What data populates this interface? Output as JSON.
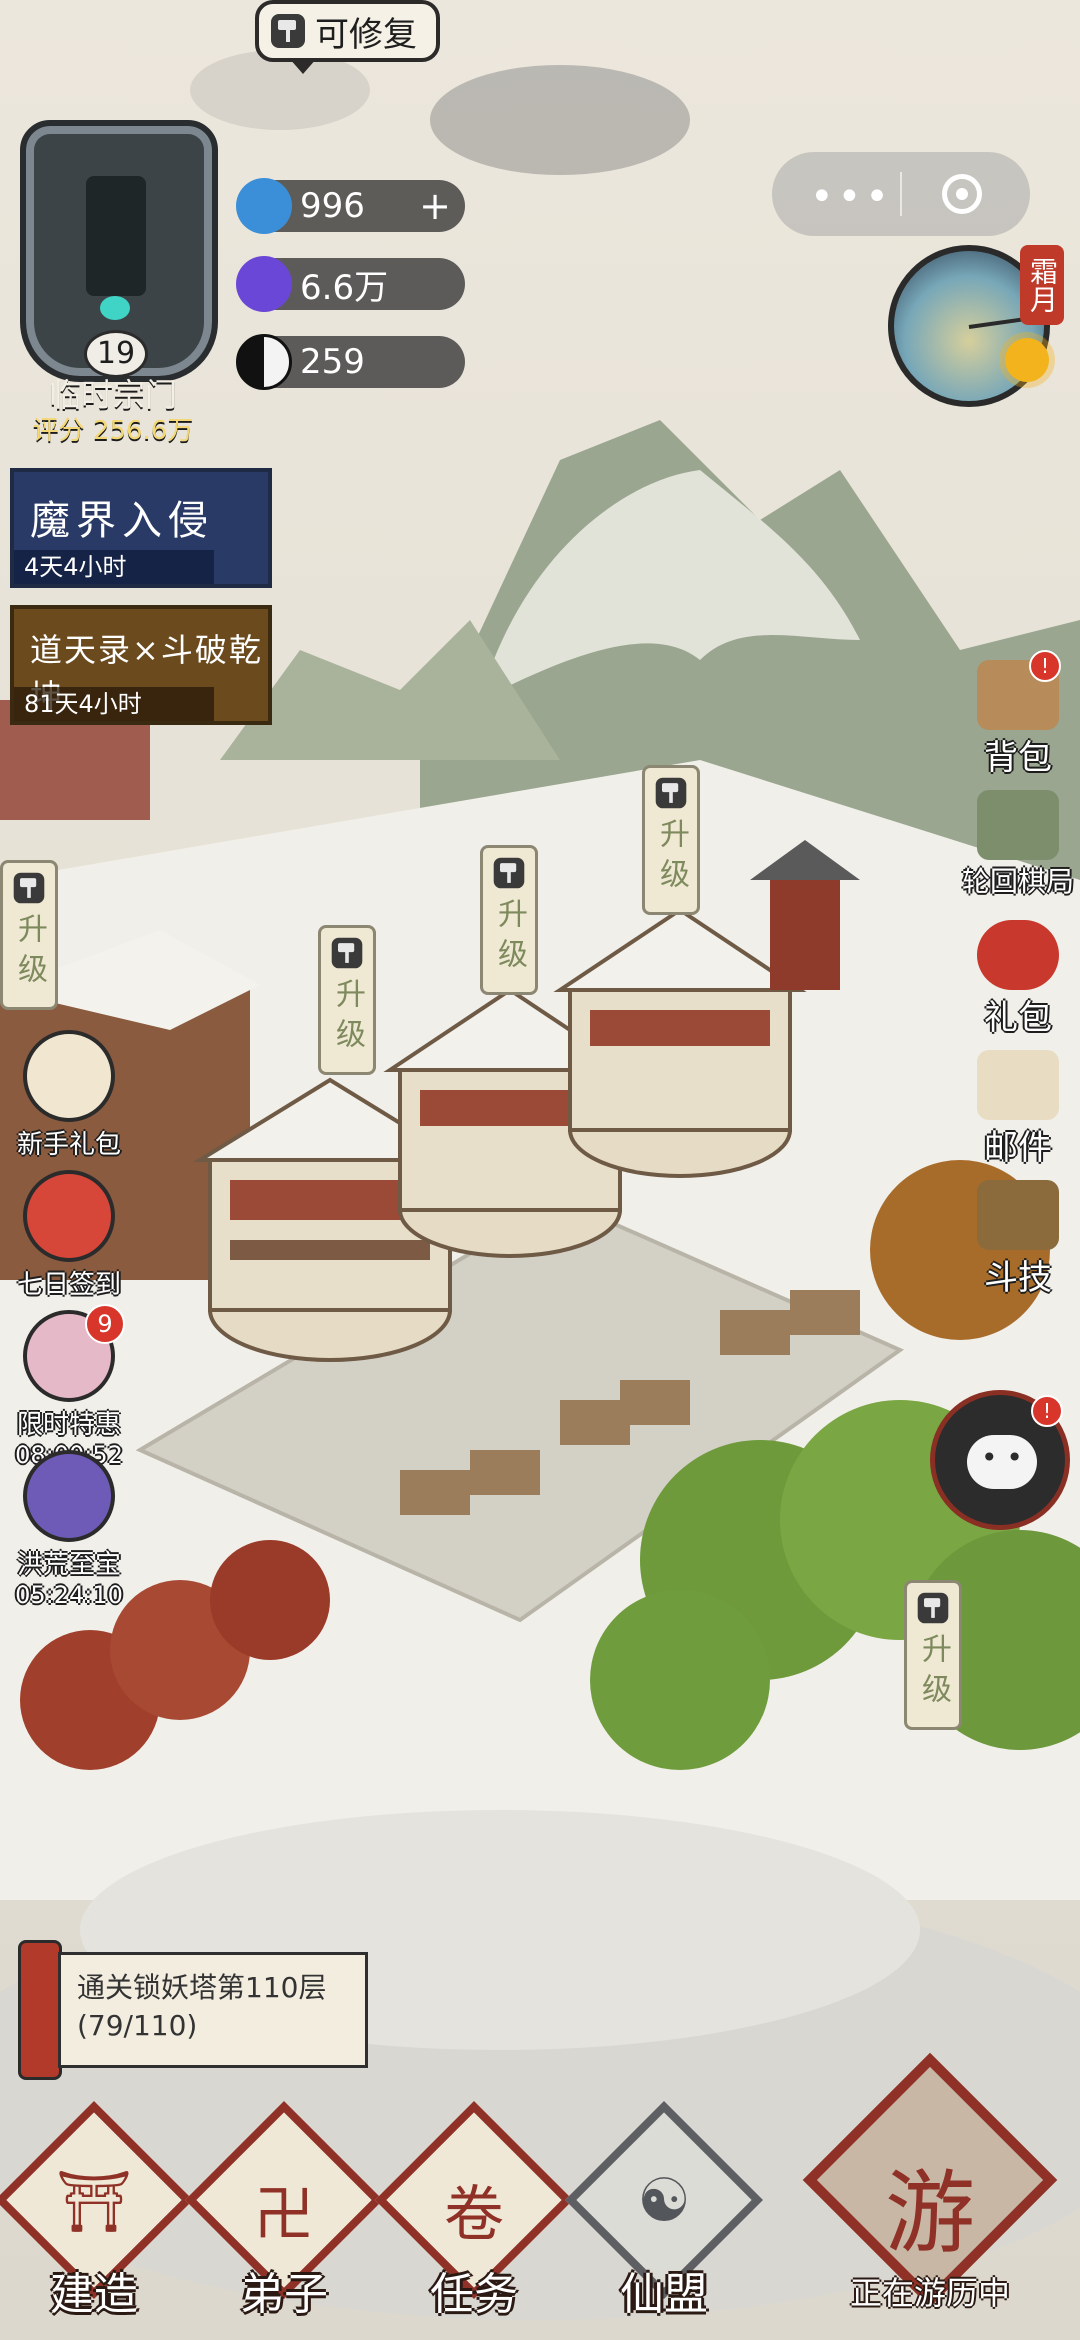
{
  "repair_tag": {
    "label": "可修复",
    "icon": "hammer-icon"
  },
  "sect": {
    "level": "19",
    "name": "临时宗门",
    "score": "评分 256.6万"
  },
  "currencies": [
    {
      "name": "spirit-coin",
      "value": "996",
      "has_plus": true,
      "color": "#3b8fd8"
    },
    {
      "name": "crystal",
      "value": "6.6万",
      "has_plus": false,
      "color": "#6a47d6"
    },
    {
      "name": "yin-yang",
      "value": "259",
      "has_plus": false,
      "color": "#222222"
    }
  ],
  "capsule": {
    "more_icon": "more-dots-icon",
    "close_icon": "target-icon"
  },
  "season": {
    "month_label": "霜月",
    "icon": "sun-icon"
  },
  "events": [
    {
      "title": "魔界入侵",
      "timer": "4天4小时",
      "bg": "#2a3a66"
    },
    {
      "title": "道天录×斗破乾坤",
      "timer": "81天4小时",
      "bg": "#6b4a1e"
    }
  ],
  "left_promos": [
    {
      "label": "新手礼包",
      "timer": "",
      "badge": ""
    },
    {
      "label": "七日签到",
      "timer": "",
      "badge": ""
    },
    {
      "label": "限时特惠",
      "timer": "08:00:52",
      "badge": "9"
    },
    {
      "label": "洪荒至宝",
      "timer": "05:24:10",
      "badge": ""
    }
  ],
  "right_menu": [
    {
      "label": "背包",
      "alert": "!"
    },
    {
      "label": "轮回棋局",
      "alert": ""
    },
    {
      "label": "礼包",
      "alert": ""
    },
    {
      "label": "邮件",
      "alert": ""
    },
    {
      "label": "斗技",
      "alert": ""
    }
  ],
  "chat": {
    "alert": "!"
  },
  "upgrade_label": "升级",
  "quest": {
    "text": "通关锁妖塔第110层(79/110)"
  },
  "bottom_nav": [
    {
      "label": "建造",
      "glyph": "⛩"
    },
    {
      "label": "弟子",
      "glyph": "卍"
    },
    {
      "label": "任务",
      "glyph": "卷"
    },
    {
      "label": "仙盟",
      "glyph": "☯"
    }
  ],
  "travel": {
    "label": "正在游历中",
    "glyph": "游"
  },
  "colors": {
    "accent_red": "#8f3126",
    "alert_red": "#d8362b",
    "upgrade_text": "#7e8a5d"
  }
}
